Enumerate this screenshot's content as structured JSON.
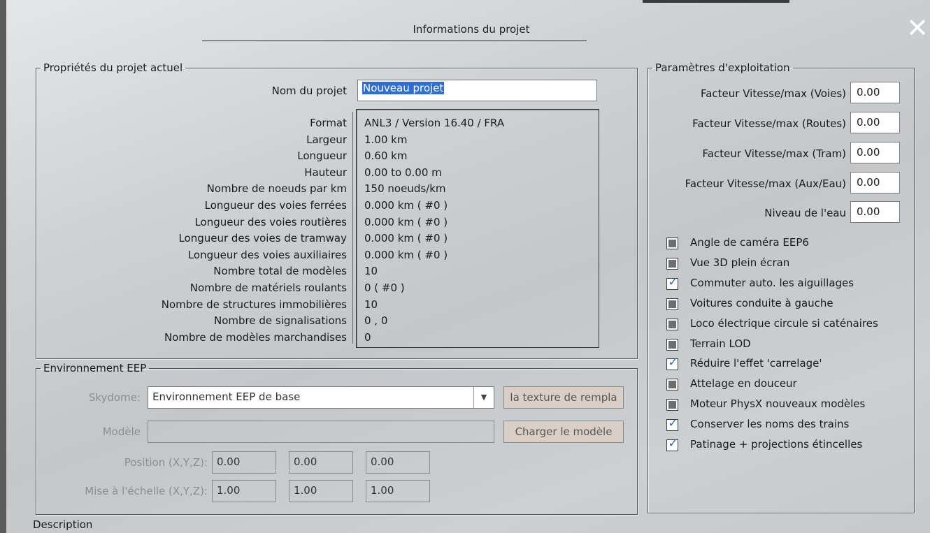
{
  "dialog": {
    "title": "Informations du projet",
    "close_glyph": "✕"
  },
  "project_props": {
    "legend": "Propriétés du projet actuel",
    "name_label": "Nom du projet",
    "name_value": "Nouveau projet",
    "rows": [
      {
        "label": "Format",
        "value": "ANL3 / Version 16.40 / FRA"
      },
      {
        "label": "Largeur",
        "value": "1.00 km"
      },
      {
        "label": "Longueur",
        "value": "0.60 km"
      },
      {
        "label": "Hauteur",
        "value": "0.00 to 0.00 m"
      },
      {
        "label": "Nombre de noeuds par km",
        "value": "150  noeuds/km"
      },
      {
        "label": "Longueur des voies ferrées",
        "value": "0.000 km ( #0 )"
      },
      {
        "label": "Longueur des voies routières",
        "value": "0.000 km ( #0 )"
      },
      {
        "label": "Longueur des voies de tramway",
        "value": "0.000 km ( #0 )"
      },
      {
        "label": "Longueur des voies auxiliaires",
        "value": "0.000 km ( #0 )"
      },
      {
        "label": "Nombre total de modèles",
        "value": "10"
      },
      {
        "label": "Nombre de matériels roulants",
        "value": "0 ( #0 )"
      },
      {
        "label": "Nombre de structures immobilières",
        "value": "10"
      },
      {
        "label": "Nombre de signalisations",
        "value": "0 , 0"
      },
      {
        "label": "Nombre de modèles marchandises",
        "value": "0"
      }
    ]
  },
  "environment": {
    "legend": "Environnement EEP",
    "skydome_label": "Skydome:",
    "skydome_value": "Environnement EEP de base",
    "texture_button": "la texture de rempla",
    "model_label": "Modèle",
    "model_value": "",
    "load_model_button": "Charger le modèle",
    "position_label": "Position (X,Y,Z):",
    "position_values": [
      "0.00",
      "0.00",
      "0.00"
    ],
    "scale_label": "Mise à l'échelle (X,Y,Z):",
    "scale_values": [
      "1.00",
      "1.00",
      "1.00"
    ]
  },
  "exploitation": {
    "legend": "Paramètres d'exploitation",
    "factors": [
      {
        "label": "Facteur Vitesse/max (Voies)",
        "value": "0.00"
      },
      {
        "label": "Facteur Vitesse/max (Routes)",
        "value": "0.00"
      },
      {
        "label": "Facteur Vitesse/max (Tram)",
        "value": "0.00"
      },
      {
        "label": "Facteur Vitesse/max (Aux/Eau)",
        "value": "0.00"
      },
      {
        "label": "Niveau de l'eau",
        "value": "0.00"
      }
    ],
    "options": [
      {
        "label": "Angle de caméra EEP6",
        "state": "indeterminate"
      },
      {
        "label": "Vue 3D plein écran",
        "state": "indeterminate"
      },
      {
        "label": "Commuter auto. les aiguillages",
        "state": "checked"
      },
      {
        "label": "Voitures conduite à gauche",
        "state": "indeterminate"
      },
      {
        "label": "Loco électrique circule si caténaires",
        "state": "indeterminate"
      },
      {
        "label": "Terrain LOD",
        "state": "indeterminate"
      },
      {
        "label": "Réduire l'effet 'carrelage'",
        "state": "checked"
      },
      {
        "label": "Attelage en douceur",
        "state": "indeterminate"
      },
      {
        "label": "Moteur PhysX nouveaux modèles",
        "state": "indeterminate"
      },
      {
        "label": "Conserver les noms des trains",
        "state": "checked"
      },
      {
        "label": "Patinage + projections étincelles",
        "state": "checked"
      }
    ]
  },
  "description": {
    "label": "Description"
  }
}
